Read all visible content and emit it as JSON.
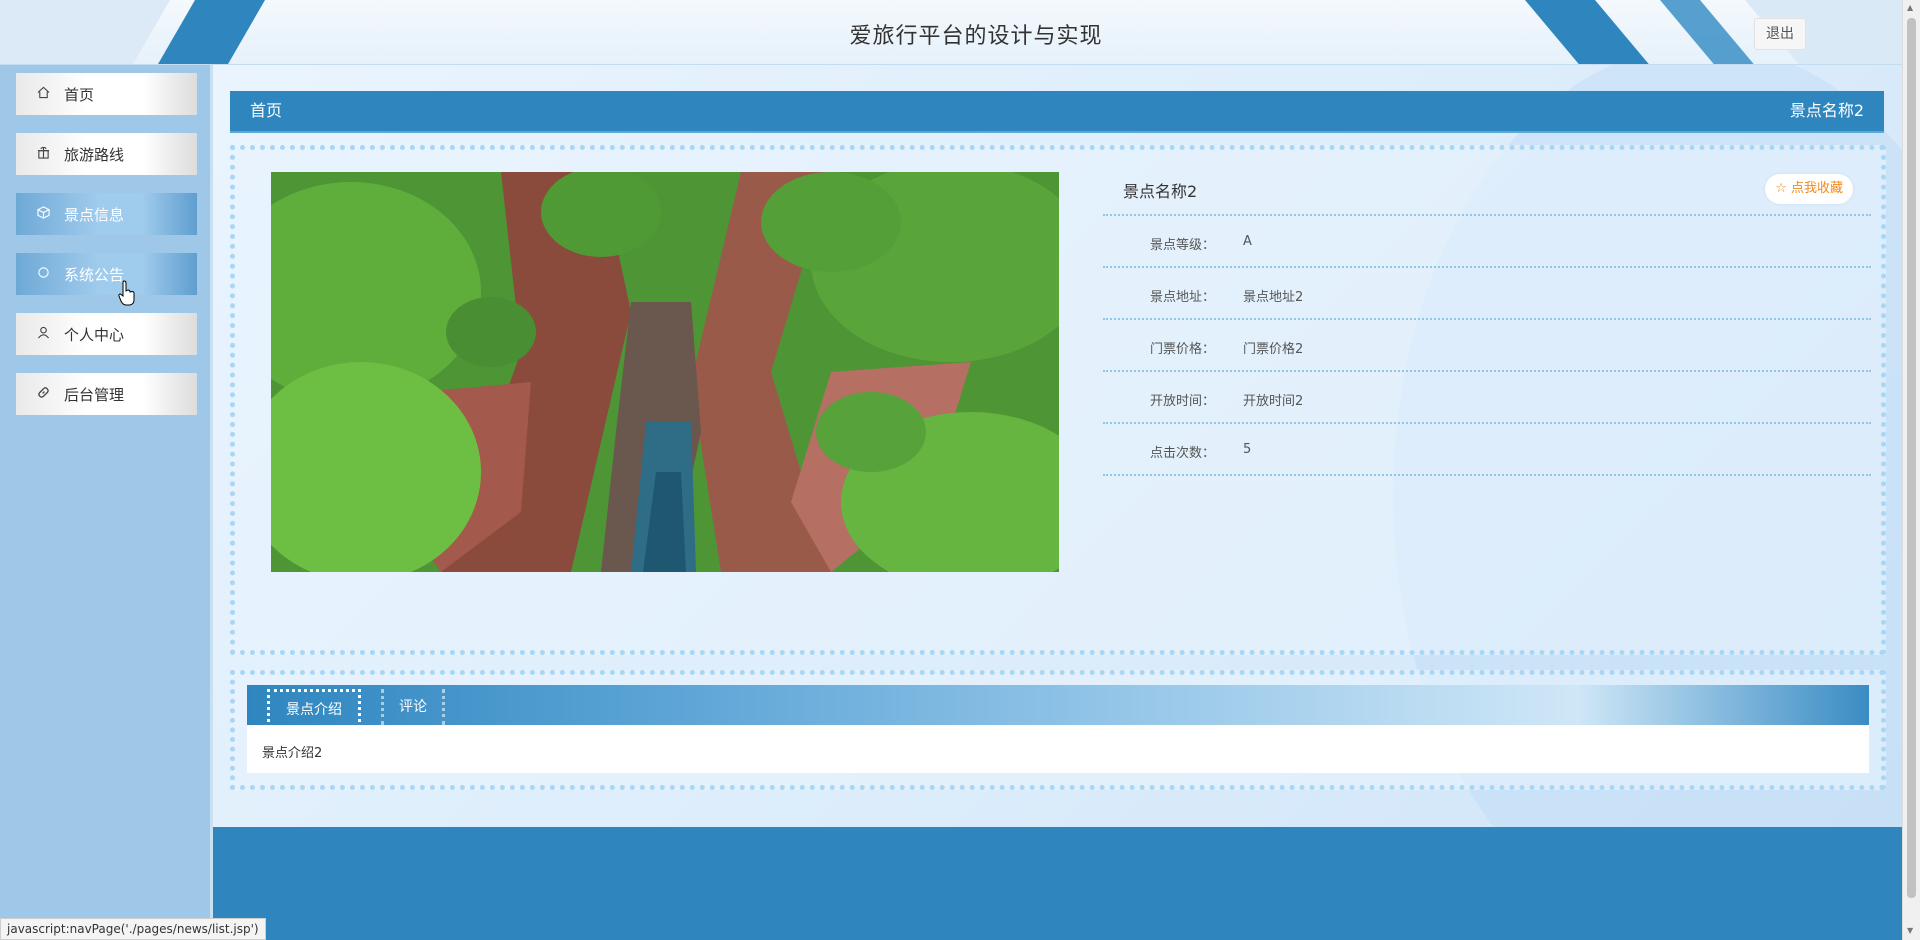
{
  "header": {
    "title": "爱旅行平台的设计与实现",
    "logout_label": "退出"
  },
  "sidebar": {
    "items": [
      {
        "label": "首页",
        "icon": "home-icon",
        "active": false
      },
      {
        "label": "旅游路线",
        "icon": "gift-icon",
        "active": false
      },
      {
        "label": "景点信息",
        "icon": "cube-icon",
        "active": true
      },
      {
        "label": "系统公告",
        "icon": "circle-icon",
        "active": true
      },
      {
        "label": "个人中心",
        "icon": "user-icon",
        "active": false
      },
      {
        "label": "后台管理",
        "icon": "link-icon",
        "active": false
      }
    ]
  },
  "breadcrumb": {
    "home": "首页",
    "current": "景点名称2"
  },
  "detail": {
    "name": "景点名称2",
    "favorite_label": "☆ 点我收藏",
    "fields": [
      {
        "label": "景点等级：",
        "value": "A"
      },
      {
        "label": "景点地址：",
        "value": "景点地址2"
      },
      {
        "label": "门票价格：",
        "value": "门票价格2"
      },
      {
        "label": "开放时间：",
        "value": "开放时间2"
      },
      {
        "label": "点击次数：",
        "value": "5"
      }
    ]
  },
  "tabs": {
    "items": [
      {
        "label": "景点介绍",
        "active": true
      },
      {
        "label": "评论",
        "active": false
      }
    ],
    "content": "景点介绍2"
  },
  "status_bar": "javascript:navPage('./pages/news/list.jsp')",
  "colors": {
    "primary": "#2f86bf",
    "sidebar": "#9ec7e8",
    "favorite": "#f08a1d"
  }
}
